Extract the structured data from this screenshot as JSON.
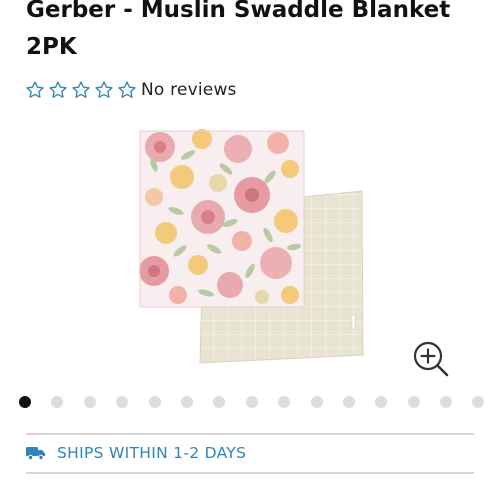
{
  "product": {
    "title": "Gerber - Muslin Swaddle Blanket 2PK"
  },
  "rating": {
    "stars_filled": 0,
    "stars_total": 5,
    "reviews_text": "No reviews",
    "star_color": "#2f84b9"
  },
  "gallery": {
    "image_alt": "Gerber Muslin Swaddle Blanket 2PK",
    "active_index": 0,
    "slide_count": 15,
    "zoom_icon": "zoom-in-icon"
  },
  "shipping": {
    "icon": "truck-icon",
    "text": "SHIPS WITHIN 1-2 DAYS",
    "color": "#2f84b9"
  }
}
